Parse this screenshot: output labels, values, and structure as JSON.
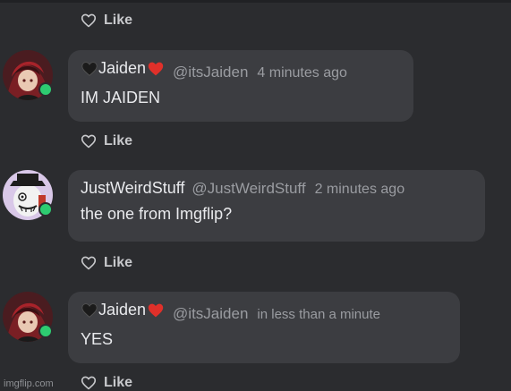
{
  "like_label": "Like",
  "comments": [
    {
      "name": "Jaiden",
      "handle": "@itsJaiden",
      "time": "4 minutes ago",
      "message": "IM JAIDEN",
      "decorated": true
    },
    {
      "name": "JustWeirdStuff",
      "handle": "@JustWeirdStuff",
      "time": "2 minutes ago",
      "message": "the one from Imgflip?",
      "decorated": false
    },
    {
      "name": "Jaiden",
      "handle": "@itsJaiden",
      "time": "in less than a minute",
      "message": "YES",
      "decorated": true
    }
  ],
  "watermark": "imgflip.com",
  "colors": {
    "background": "#2b2c2f",
    "bubble": "#3c3d41",
    "online": "#2ecc71",
    "heart_red": "#e0302a",
    "heart_black": "#1b1b1b"
  }
}
